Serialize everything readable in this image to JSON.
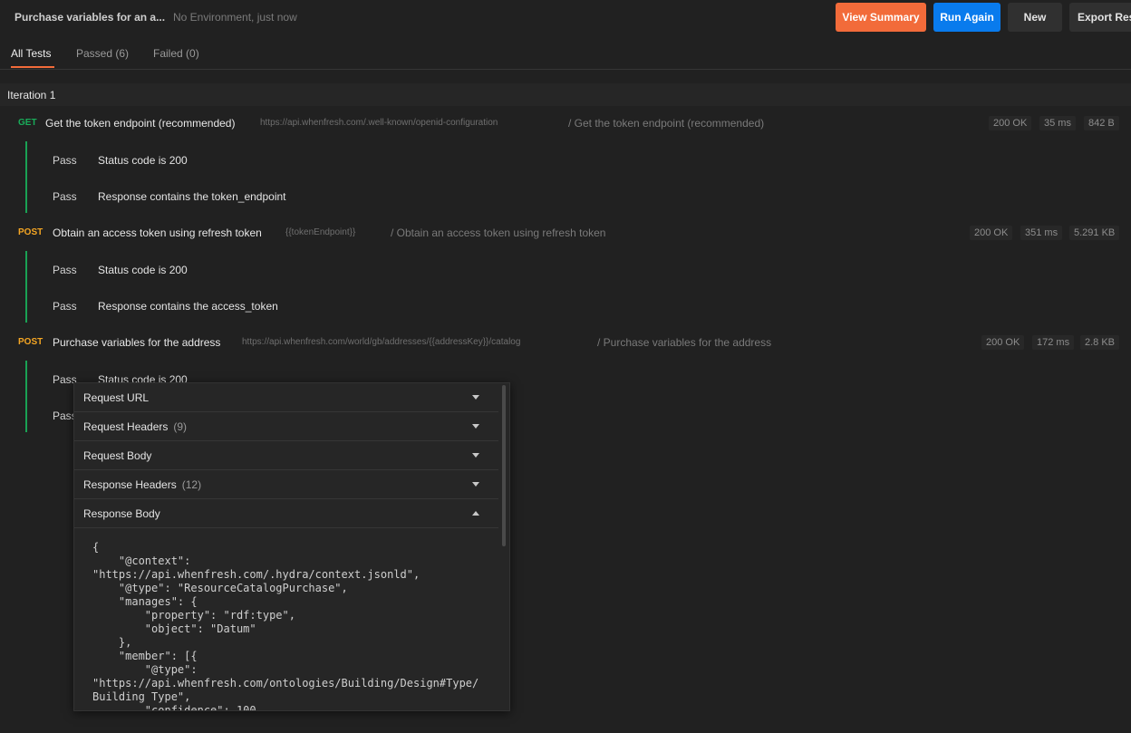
{
  "header": {
    "run_title": "Purchase variables for an a...",
    "run_meta": "No Environment, just now",
    "buttons": {
      "view_summary": "View Summary",
      "run_again": "Run Again",
      "new": "New",
      "export": "Export Res"
    },
    "colors": {
      "view_summary": "#f26b3a",
      "run_again": "#097bed"
    }
  },
  "tabs": [
    {
      "label": "All Tests",
      "active": true
    },
    {
      "label": "Passed (6)",
      "active": false
    },
    {
      "label": "Failed (0)",
      "active": false
    }
  ],
  "iteration": {
    "label": "Iteration 1"
  },
  "requests": [
    {
      "method": "GET",
      "name": "Get the token endpoint (recommended)",
      "url": "https://api.whenfresh.com/.well-known/openid-configuration",
      "path": "/ Get the token endpoint (recommended)",
      "status": "200 OK",
      "time": "35 ms",
      "size": "842 B",
      "tests": [
        {
          "result": "Pass",
          "name": "Status code is 200"
        },
        {
          "result": "Pass",
          "name": "Response contains the token_endpoint"
        }
      ]
    },
    {
      "method": "POST",
      "name": "Obtain an access token using refresh token",
      "url": "{{tokenEndpoint}}",
      "path": "/ Obtain an access token using refresh token",
      "status": "200 OK",
      "time": "351 ms",
      "size": "5.291 KB",
      "tests": [
        {
          "result": "Pass",
          "name": "Status code is 200"
        },
        {
          "result": "Pass",
          "name": "Response contains the access_token"
        }
      ]
    },
    {
      "method": "POST",
      "name": "Purchase variables for the address",
      "url": "https://api.whenfresh.com/world/gb/addresses/{{addressKey}}/catalog",
      "path": "/ Purchase variables for the address",
      "status": "200 OK",
      "time": "172 ms",
      "size": "2.8 KB",
      "tests": [
        {
          "result": "Pass",
          "name": "Status code is 200"
        },
        {
          "result": "Pass",
          "name": ""
        }
      ]
    }
  ],
  "details_popup": {
    "sections": [
      {
        "label": "Request URL",
        "count": "",
        "expanded": false
      },
      {
        "label": "Request Headers",
        "count": "(9)",
        "expanded": false
      },
      {
        "label": "Request Body",
        "count": "",
        "expanded": false
      },
      {
        "label": "Response Headers",
        "count": "(12)",
        "expanded": false
      },
      {
        "label": "Response Body",
        "count": "",
        "expanded": true
      }
    ],
    "response_body": "{\n    \"@context\":\n\"https://api.whenfresh.com/.hydra/context.jsonld\",\n    \"@type\": \"ResourceCatalogPurchase\",\n    \"manages\": {\n        \"property\": \"rdf:type\",\n        \"object\": \"Datum\"\n    },\n    \"member\": [{\n        \"@type\":\n\"https://api.whenfresh.com/ontologies/Building/Design#Type/\nBuilding Type\",\n        \"confidence\": 100"
  }
}
